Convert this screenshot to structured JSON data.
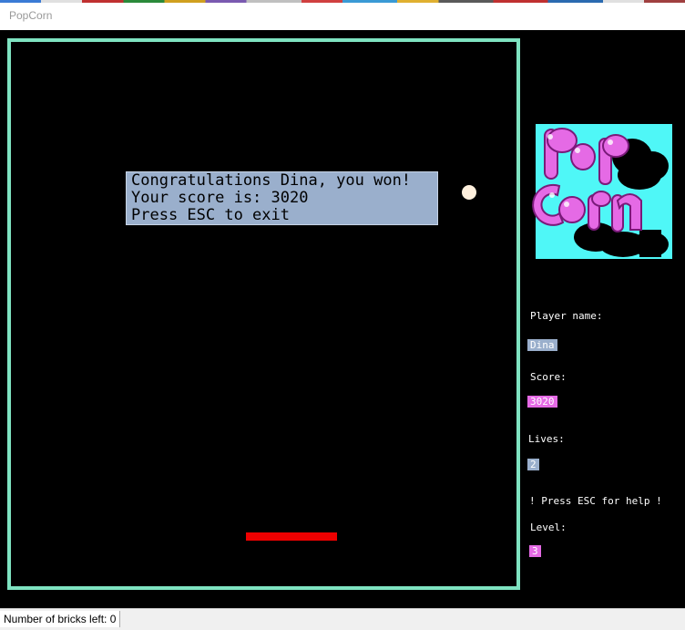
{
  "window": {
    "title": "PopCorn"
  },
  "game": {
    "message_line1": "Congratulations Dina, you won!",
    "message_line2": "Your score is: 3020",
    "message_line3": "Press ESC to exit"
  },
  "sidebar": {
    "logo_text": "PopCorn",
    "player_label": "Player name:",
    "player_value": "Dina",
    "score_label": "Score:",
    "score_value": "3020",
    "lives_label": "Lives:",
    "lives_value": "2",
    "help_text": "! Press ESC for help !",
    "level_label": "Level:",
    "level_value": "3"
  },
  "status": {
    "text": "Number of bricks left: 0"
  },
  "colors": {
    "frame": "#7fe3c1",
    "message_bg": "#9aafcc",
    "paddle": "#ee0000",
    "ball": "#fff0dd",
    "logo_bg": "#4ff7f7",
    "logo_letters": "#e56ae5",
    "value_pink": "#e56ae5"
  }
}
